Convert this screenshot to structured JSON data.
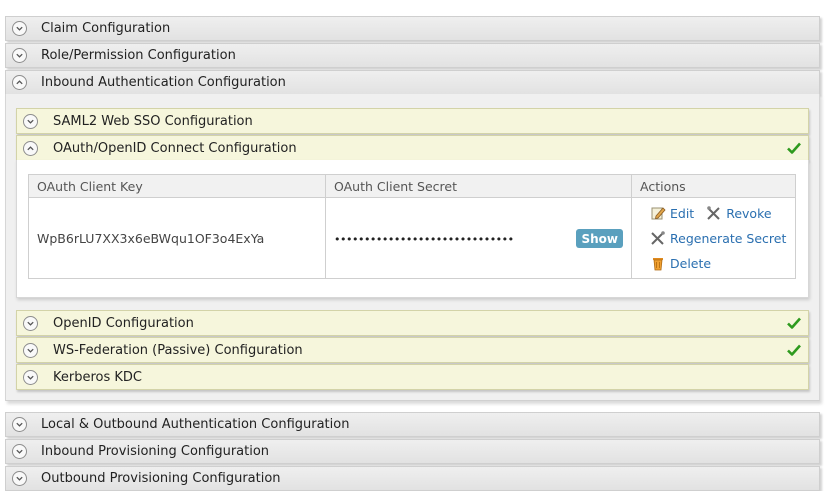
{
  "sections": [
    {
      "label": "Claim Configuration",
      "expanded": false
    },
    {
      "label": "Role/Permission Configuration",
      "expanded": false
    },
    {
      "label": "Inbound Authentication Configuration",
      "expanded": true
    },
    {
      "label": "Local & Outbound Authentication Configuration",
      "expanded": false
    },
    {
      "label": "Inbound Provisioning Configuration",
      "expanded": false
    },
    {
      "label": "Outbound Provisioning Configuration",
      "expanded": false
    }
  ],
  "inbound": {
    "saml": {
      "label": "SAML2 Web SSO Configuration",
      "expanded": false,
      "configured": false
    },
    "oauth": {
      "label": "OAuth/OpenID Connect Configuration",
      "expanded": true,
      "configured": true
    },
    "openid": {
      "label": "OpenID Configuration",
      "expanded": false,
      "configured": true
    },
    "wsfed": {
      "label": "WS-Federation (Passive) Configuration",
      "expanded": false,
      "configured": true
    },
    "kerberos": {
      "label": "Kerberos KDC",
      "expanded": false,
      "configured": false
    }
  },
  "oauth_table": {
    "headers": [
      "OAuth Client Key",
      "OAuth Client Secret",
      "Actions"
    ],
    "client_key": "WpB6rLU7XX3x6eBWqu1OF3o4ExYa",
    "client_secret_masked": "••••••••••••••••••••••••••••••",
    "show_label": "Show",
    "actions": {
      "edit": "Edit",
      "revoke": "Revoke",
      "regenerate": "Regenerate Secret",
      "delete": "Delete"
    }
  },
  "colors": {
    "link": "#2a6fb0",
    "check": "#2e9a1e",
    "show_button": "#5aa0be",
    "sub_header": "#f6f6dc"
  },
  "icons": {
    "collapsed": "chevron-down-icon",
    "expanded": "chevron-up-icon",
    "configured": "checkmark-icon",
    "edit": "edit-icon",
    "revoke": "revoke-icon",
    "regenerate": "regenerate-icon",
    "delete": "trash-icon"
  }
}
